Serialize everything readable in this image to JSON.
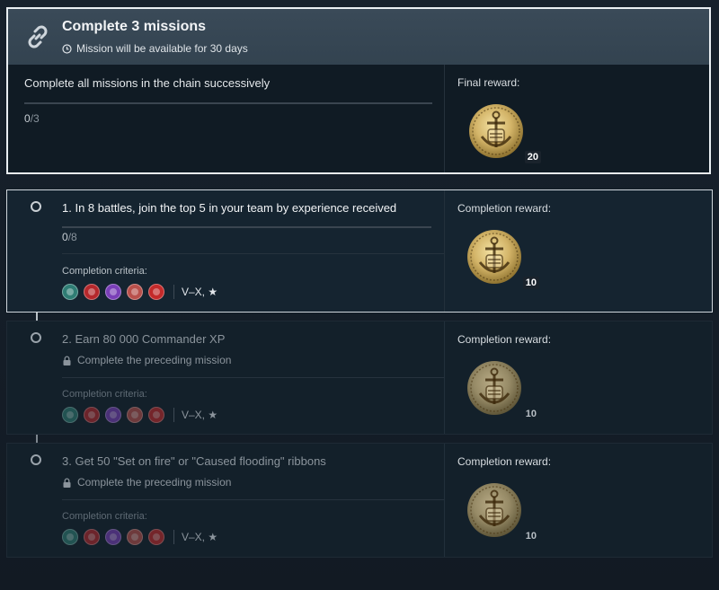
{
  "chain": {
    "title": "Complete 3 missions",
    "availability": "Mission will be available for 30 days",
    "description": "Complete all missions in the chain successively",
    "progress_current": "0",
    "progress_total": "/3",
    "reward_label": "Final reward:",
    "reward_count": "20",
    "reward_icon": "anchor-coin-icon"
  },
  "missions": [
    {
      "title": "1. In 8 battles, join the top 5 in your team by experience received",
      "progress_current": "0",
      "progress_total": "/8",
      "criteria_label": "Completion criteria:",
      "tiers": "V–X, ★",
      "reward_label": "Completion reward:",
      "reward_count": "10",
      "state": "active"
    },
    {
      "title": "2. Earn 80 000 Commander XP",
      "lock_text": "Complete the preceding mission",
      "criteria_label": "Completion criteria:",
      "tiers": "V–X, ★",
      "reward_label": "Completion reward:",
      "reward_count": "10",
      "state": "locked"
    },
    {
      "title": "3. Get 50 \"Set on fire\" or \"Caused flooding\" ribbons",
      "lock_text": "Complete the preceding mission",
      "criteria_label": "Completion criteria:",
      "tiers": "V–X, ★",
      "reward_label": "Completion reward:",
      "reward_count": "10",
      "state": "locked"
    }
  ],
  "nation_icons": [
    "destroyer-class-icon",
    "cruiser-class-icon",
    "battleship-class-icon",
    "carrier-class-icon",
    "submarine-class-icon"
  ],
  "colors": {
    "nation_1": "#2f7d74",
    "nation_2": "#b5282c",
    "nation_3": "#7a3fb8",
    "nation_4": "#b9504b",
    "nation_5": "#c42a2a",
    "coin_gold": "#d6b769"
  }
}
